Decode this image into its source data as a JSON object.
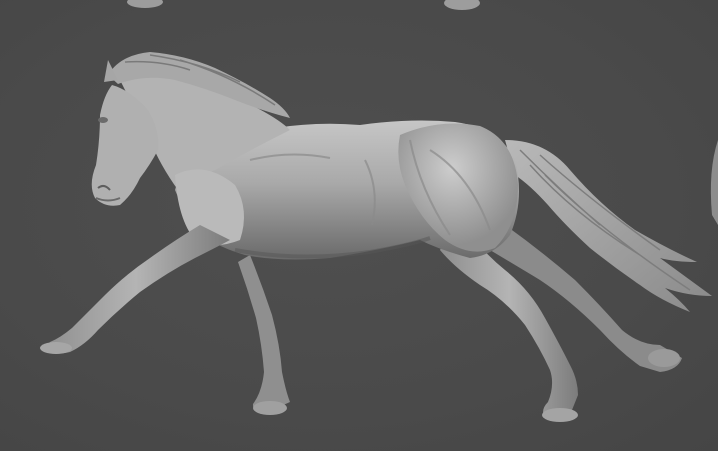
{
  "scene": {
    "subject_icon": "horse-sculpt-icon",
    "colors": {
      "background": "#4b4b4b",
      "clay_light": "#bdbdbd",
      "clay_mid": "#9a9a9a",
      "clay_dark": "#5c5c5c"
    }
  }
}
